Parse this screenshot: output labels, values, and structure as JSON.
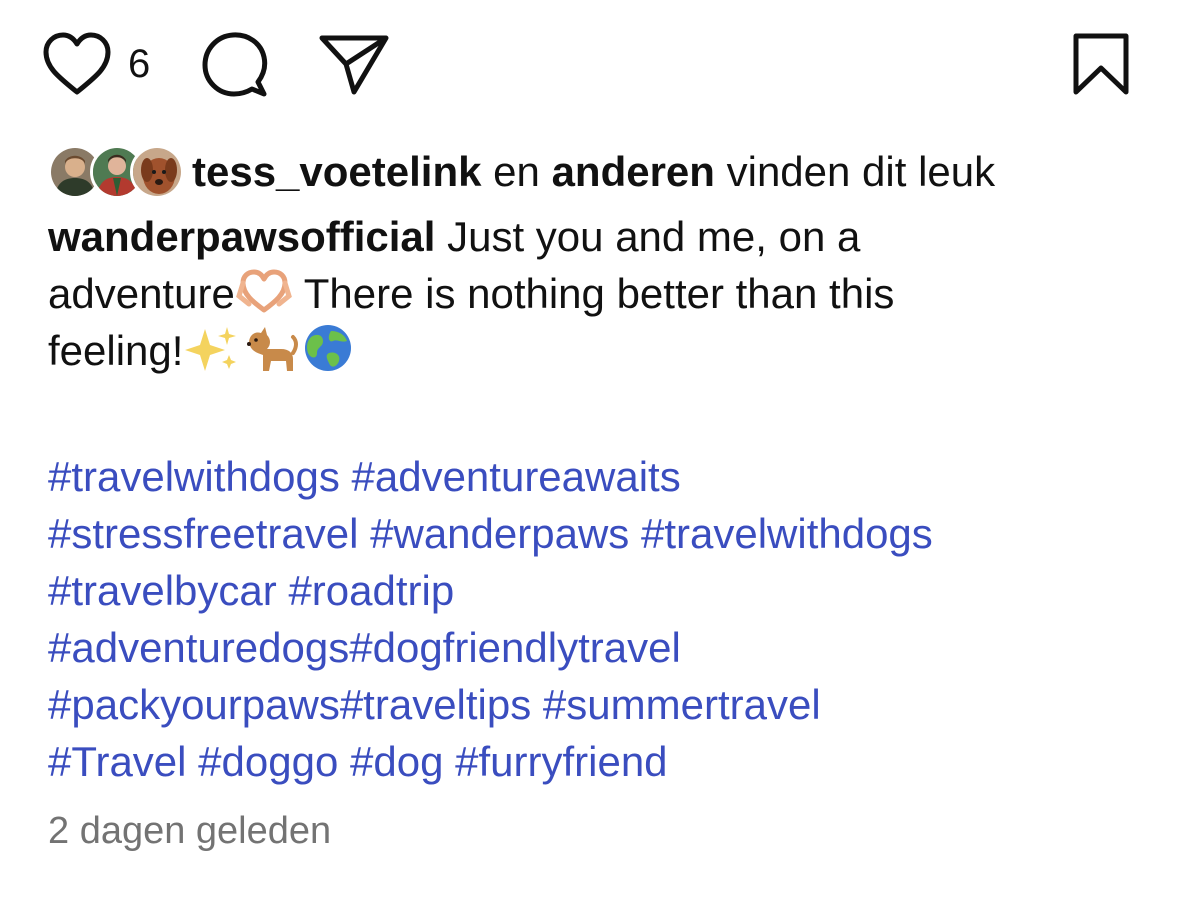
{
  "actions": {
    "like_icon": "heart-outline-icon",
    "like_count": "6",
    "comment_icon": "comment-bubble-icon",
    "share_icon": "paper-plane-icon",
    "save_icon": "bookmark-icon"
  },
  "likes": {
    "avatars": [
      "avatar-person-1",
      "avatar-person-2",
      "avatar-dog"
    ],
    "first_user": "tess_voetelink",
    "connector": " en ",
    "others": "anderen",
    "suffix": " vinden dit leuk"
  },
  "caption": {
    "username": "wanderpawsofficial",
    "line1_text": " Just you and me, on a",
    "line2_text_a": "adventure",
    "line2_emoji": "heart-hands-emoji",
    "line2_text_b": " There is nothing better than this",
    "line3_text": "feeling!",
    "line3_emojis": [
      "sparkles-emoji",
      "dog-emoji",
      "globe-emoji"
    ]
  },
  "hashtags": [
    [
      "#travelwithdogs",
      "#adventureawaits"
    ],
    [
      "#stressfreetravel",
      "#wanderpaws",
      "#travelwithdogs"
    ],
    [
      "#travelbycar",
      "#roadtrip"
    ],
    [
      "#adventuredogs",
      "#dogfriendlytravel"
    ],
    [
      "#packyourpaws",
      "#traveltips",
      "#summertravel"
    ],
    [
      "#Travel",
      "#doggo",
      "#dog",
      "#furryfriend"
    ]
  ],
  "timestamp": "2 dagen geleden",
  "colors": {
    "text": "#111111",
    "hashtag": "#3a4dbf",
    "muted": "#737373",
    "background": "#ffffff"
  }
}
